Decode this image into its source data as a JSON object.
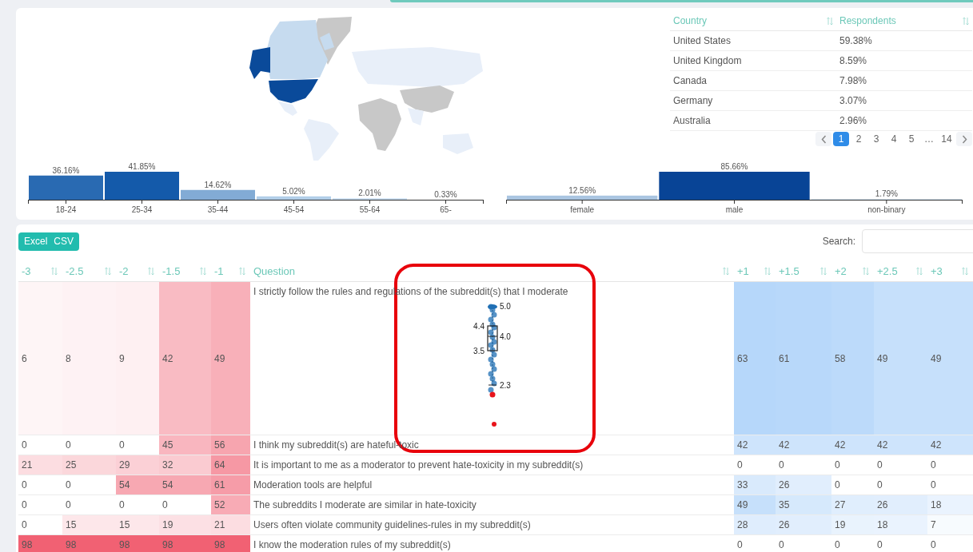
{
  "country_table": {
    "columns": [
      "Country",
      "Respondents"
    ],
    "rows": [
      {
        "country": "United States",
        "respondents": "59.38%"
      },
      {
        "country": "United Kingdom",
        "respondents": "8.59%"
      },
      {
        "country": "Canada",
        "respondents": "7.98%"
      },
      {
        "country": "Germany",
        "respondents": "3.07%"
      },
      {
        "country": "Australia",
        "respondents": "2.96%"
      }
    ],
    "pagination": [
      {
        "label": "1",
        "selected": true
      },
      {
        "label": "2",
        "selected": false
      },
      {
        "label": "3",
        "selected": false
      },
      {
        "label": "4",
        "selected": false
      },
      {
        "label": "5",
        "selected": false
      },
      {
        "label": "…",
        "selected": false
      },
      {
        "label": "14",
        "selected": false
      }
    ]
  },
  "age_chart": {
    "chart_data": {
      "type": "bar",
      "categories": [
        "18-24",
        "25-34",
        "35-44",
        "45-54",
        "55-64",
        "65-"
      ],
      "values": [
        36.16,
        41.85,
        14.62,
        5.02,
        2.01,
        0.33
      ],
      "value_labels": [
        "36.16%",
        "41.85%",
        "14.62%",
        "5.02%",
        "2.01%",
        "0.33%"
      ]
    }
  },
  "gender_chart": {
    "chart_data": {
      "type": "bar",
      "categories": [
        "female",
        "male",
        "non-binary"
      ],
      "values": [
        12.56,
        85.66,
        1.79
      ],
      "value_labels": [
        "12.56%",
        "85.66%",
        "1.79%"
      ]
    }
  },
  "export_buttons": [
    "Excel",
    "CSV"
  ],
  "search": {
    "label": "Search:"
  },
  "table": {
    "columns": [
      {
        "label": "-3",
        "kind": "negative"
      },
      {
        "label": "-2.5",
        "kind": "negative"
      },
      {
        "label": "-2",
        "kind": "negative"
      },
      {
        "label": "-1.5",
        "kind": "negative"
      },
      {
        "label": "-1",
        "kind": "negative"
      },
      {
        "label": "Question",
        "kind": "question"
      },
      {
        "label": "+1",
        "kind": "positive"
      },
      {
        "label": "+1.5",
        "kind": "positive"
      },
      {
        "label": "+2",
        "kind": "positive"
      },
      {
        "label": "+2.5",
        "kind": "positive"
      },
      {
        "label": "+3",
        "kind": "positive"
      }
    ],
    "rows": [
      {
        "cells": [
          "6",
          "8",
          "9",
          "42",
          "49",
          "I strictly follow the rules and regulations of the subreddit(s) that I moderate",
          "63",
          "61",
          "58",
          "49",
          "49"
        ],
        "boxplot": {
          "labels": [
            "5.0",
            "4.4",
            "4.0",
            "3.5",
            "2.3"
          ]
        }
      },
      {
        "cells": [
          "0",
          "0",
          "0",
          "45",
          "56",
          "I think my subreddit(s) are hateful-toxic",
          "42",
          "42",
          "42",
          "42",
          "42"
        ]
      },
      {
        "cells": [
          "21",
          "25",
          "29",
          "32",
          "64",
          "It is important to me as a moderator to prevent hate-toxicity in my subreddit(s)",
          "0",
          "0",
          "0",
          "0",
          "0"
        ]
      },
      {
        "cells": [
          "0",
          "0",
          "54",
          "54",
          "61",
          "Moderation tools are helpful",
          "33",
          "26",
          "0",
          "0",
          "0"
        ]
      },
      {
        "cells": [
          "0",
          "0",
          "0",
          "0",
          "52",
          "The subreddits I moderate are similar in hate-toxicity",
          "49",
          "35",
          "27",
          "26",
          "18"
        ]
      },
      {
        "cells": [
          "0",
          "15",
          "15",
          "19",
          "21",
          "Users often violate community guidelines-rules in my subreddit(s)",
          "28",
          "26",
          "19",
          "18",
          "7"
        ]
      },
      {
        "cells": [
          "98",
          "98",
          "98",
          "98",
          "98",
          "I know the moderation rules of my subreddit(s)",
          "0",
          "0",
          "0",
          "0",
          "0"
        ]
      }
    ]
  },
  "annotation": {
    "color": "#e8000b"
  }
}
